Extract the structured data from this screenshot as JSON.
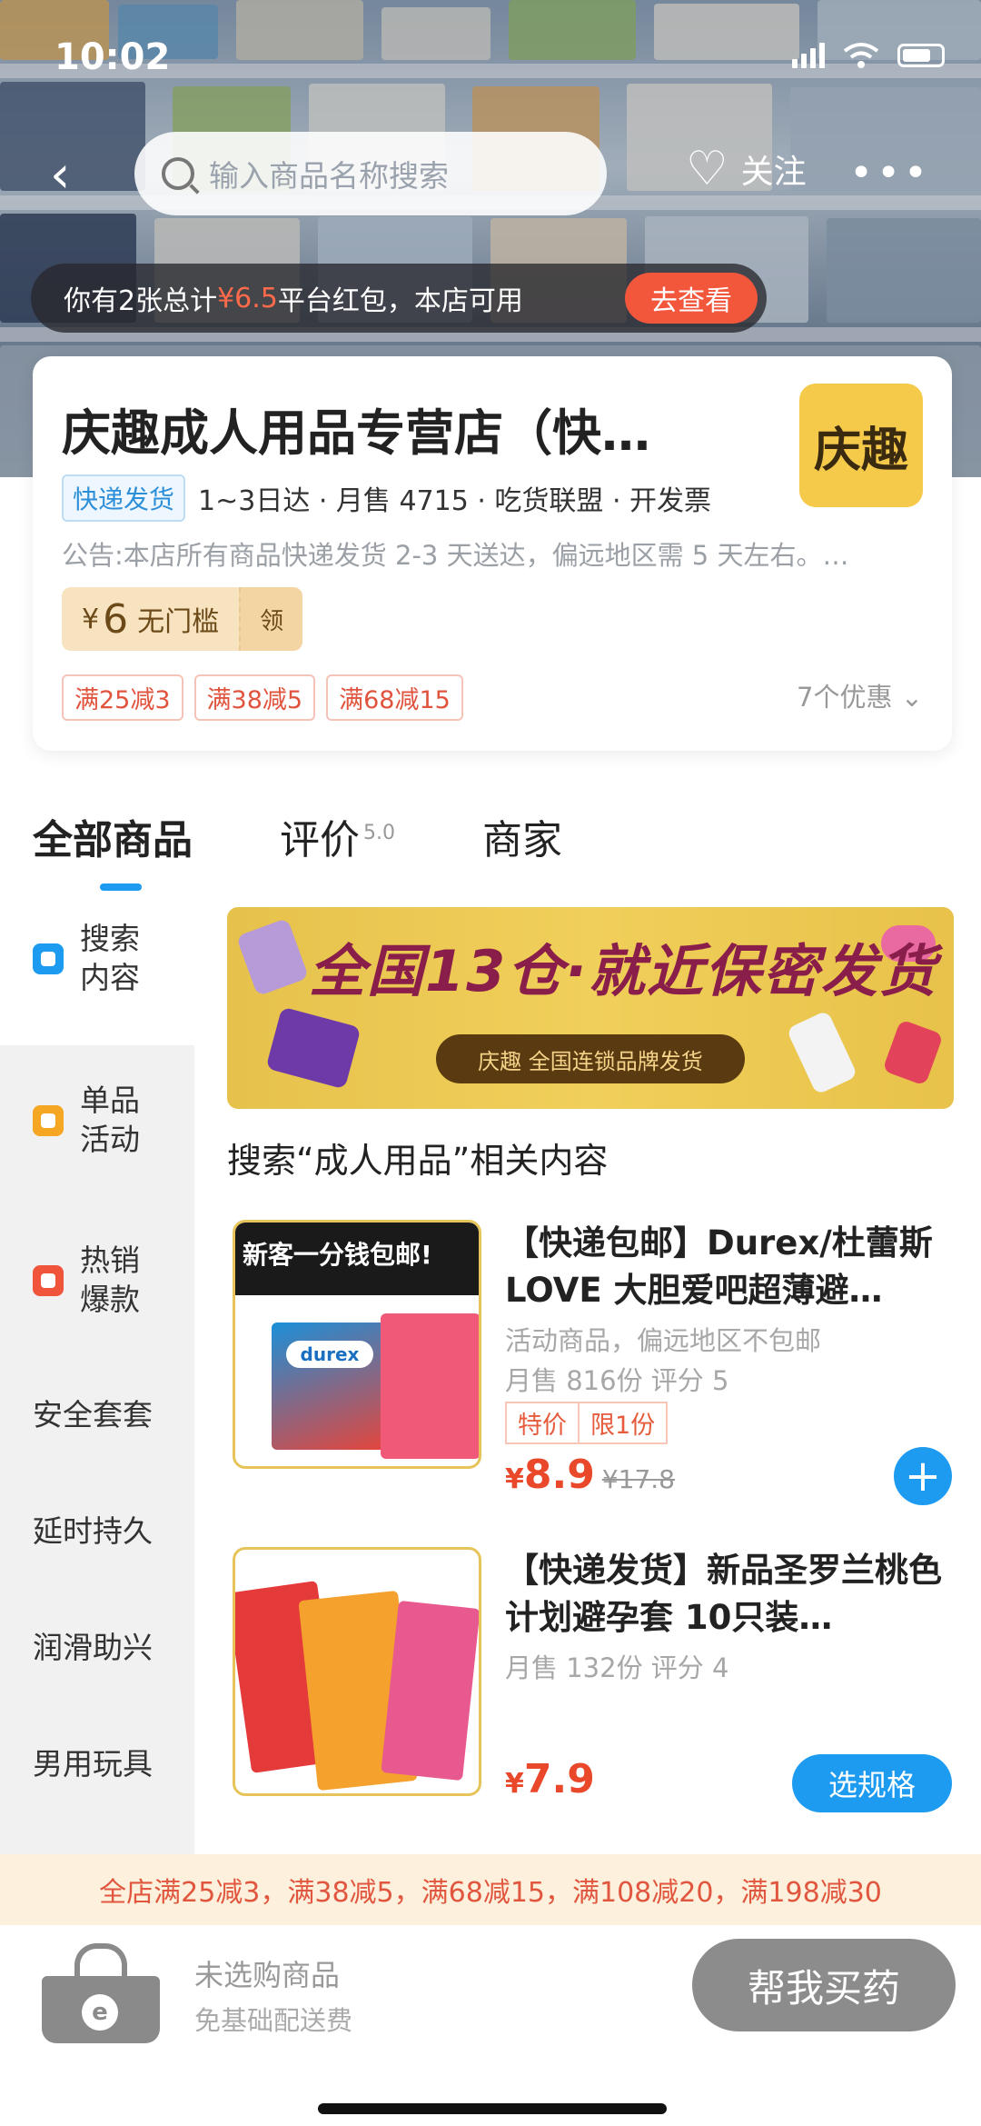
{
  "status_bar": {
    "time": "10:02"
  },
  "header": {
    "search_placeholder": "输入商品名称搜索",
    "follow_label": "关注",
    "more_label": "•••",
    "red_packet": {
      "text_prefix": "你有2张总计",
      "amount": "¥6.5",
      "text_suffix": "平台红包，本店可用",
      "button": "去查看"
    }
  },
  "store": {
    "name": "庆趣成人用品专营店（快…",
    "logo_text": "庆趣",
    "delivery_tag": "快递发货",
    "meta": "1~3日达 · 月售 4715 · 吃货联盟 · 开发票",
    "notice": "公告:本店所有商品快递发货 2-3 天送达，偏远地区需 5 天左右。…",
    "coupon": {
      "currency": "¥",
      "value": "6",
      "label": "无门槛",
      "action": "领"
    },
    "promos": [
      "满25减3",
      "满38减5",
      "满68减15"
    ],
    "promo_count": "7个优惠 ⌄"
  },
  "tabs": [
    {
      "label": "全部商品",
      "active": true
    },
    {
      "label": "评价",
      "score": "5.0"
    },
    {
      "label": "商家"
    }
  ],
  "sidebar": {
    "items": [
      {
        "label_1": "搜索",
        "label_2": "内容",
        "icon_color": "#1d9bf0"
      },
      {
        "label_1": "单品",
        "label_2": "活动",
        "icon_color": "#f5a623"
      },
      {
        "label_1": "热销",
        "label_2": "爆款",
        "icon_color": "#f0553b"
      },
      {
        "label_1": "安全套套"
      },
      {
        "label_1": "延时持久"
      },
      {
        "label_1": "润滑助兴"
      },
      {
        "label_1": "男用玩具"
      }
    ]
  },
  "banner": {
    "slogan": "全国13仓·就近保密发货",
    "strip": "庆趣 全国连锁品牌发货"
  },
  "section_title": "搜索“成人用品”相关内容",
  "products": [
    {
      "title": "【快递包邮】Durex/杜蕾斯 LOVE 大胆爱吧超薄避…",
      "subtitle": "活动商品，偏远地区不包邮",
      "sales": "月售 816份   评分 5",
      "tags": [
        "特价",
        "限1份"
      ],
      "price": "8.9",
      "old_price": "¥17.8",
      "thumb_text": "新客一分钱包邮!",
      "brand_text": "durex"
    },
    {
      "title": "【快递发货】新品圣罗兰桃色计划避孕套 10只装…",
      "sales": "月售 132份   评分 4",
      "price": "7.9",
      "spec_button": "选规格"
    }
  ],
  "promo_bar": "全店满25减3，满38减5，满68减15，满108减20，满198减30",
  "cart": {
    "empty_text": "未选购商品",
    "delivery_text": "免基础配送费",
    "buy_button": "帮我买药"
  }
}
